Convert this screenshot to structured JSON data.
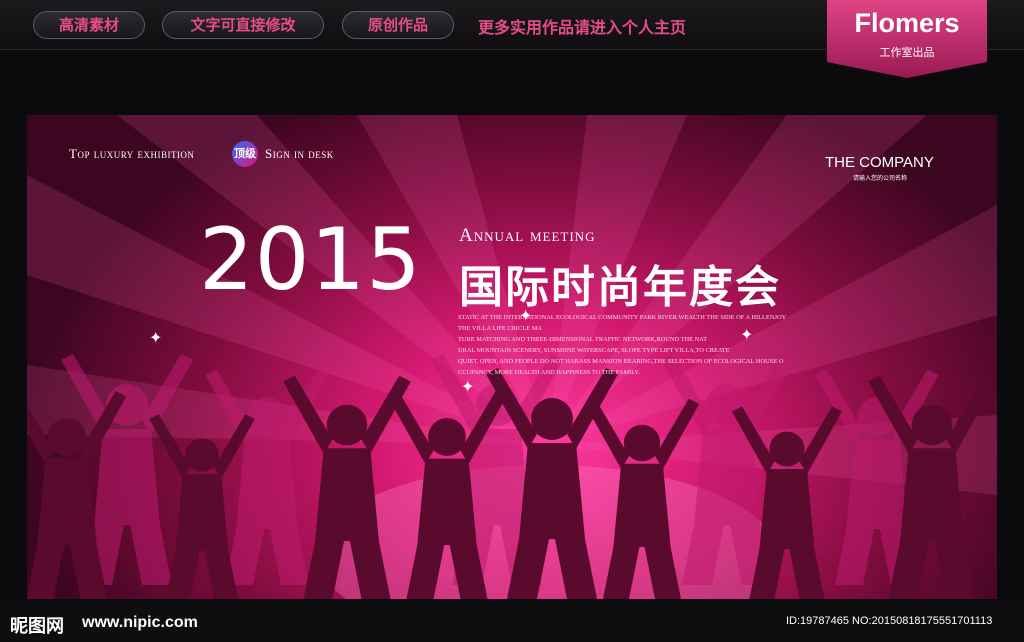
{
  "topbar": {
    "tags": [
      "高清素材",
      "文字可直接修改",
      "原创作品"
    ],
    "more_link": "更多实用作品请进入个人主页"
  },
  "brand": {
    "name": "Flomers",
    "subtitle": "工作室出品"
  },
  "banner": {
    "top_left_text": "Top luxury exhibition",
    "badge_text": "顶级",
    "top_left_text_2": "Sign in desk",
    "company_name": "THE COMPANY",
    "company_sub": "请输入您的公司名称",
    "year": "2015",
    "annual": "Annual meeting",
    "chinese_title": "国际时尚年度会",
    "paragraph_lines": [
      "STATIC AT THE INTERNATIONAL ECOLOGICAL COMMUNITY PARK RIVER WEALTH THE SIDE OF A HILLENJOY",
      "THE VILLA LIFE CIRCLE MA",
      "TURE MATCHING AND THREE-DIMENSIONAL TRAFFIC NETWORK,ROUND THE NAT",
      "URAL MOUNTAIN SCENERY, SUNSHINE WATERSCAPE, SLOPE TYPE LIFT VILLA,TO CREATE",
      "QUIET, OPEN, AND PEOPLE DO NOT HARASS MANSION BEARING,THE SELECTION OF ECOLOGICAL HOUSE O",
      "CCUPANCY, MORE HEALTH AND HAPPINESS TO THE FAMILY."
    ],
    "colors": {
      "magenta": "#e2147a",
      "deep": "#3d0620",
      "accent": "#e64c86"
    }
  },
  "footer": {
    "logo_text": "昵图网",
    "site_url": "www.nipic.com",
    "id_line": "ID:19787465 NO:20150818175551701113"
  }
}
